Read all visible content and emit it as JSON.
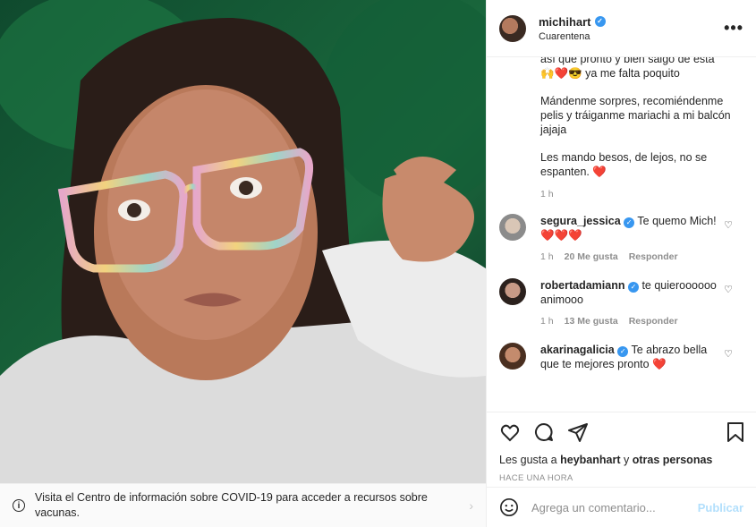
{
  "post": {
    "username": "michihart",
    "location": "Cuarentena",
    "more_label": "•••"
  },
  "caption": {
    "line1": "así que pronto y bien salgo de esta",
    "line2": "🙌❤️😎 ya me falta poquito",
    "para2": "Mándenme sorpres, recomiéndenme pelis y tráiganme mariachi a mi balcón jajaja",
    "para3": "Les mando besos, de lejos, no se espanten. ❤️",
    "time": "1 h"
  },
  "comments": [
    {
      "user": "segura_jessica",
      "verified": true,
      "text": "Te quemo Mich! ❤️❤️❤️",
      "time": "1 h",
      "likes": "20 Me gusta",
      "reply": "Responder"
    },
    {
      "user": "robertadamiann",
      "verified": true,
      "text": "te quieroooooo animooo",
      "time": "1 h",
      "likes": "13 Me gusta",
      "reply": "Responder"
    },
    {
      "user": "akarinagalicia",
      "verified": true,
      "text": "Te abrazo bella que te mejores pronto ❤️"
    }
  ],
  "likes_line": {
    "prefix": "Les gusta a",
    "user": "heybanhart",
    "joiner": "y",
    "others": "otras personas"
  },
  "timestamp": "HACE UNA HORA",
  "add_comment": {
    "placeholder": "Agrega un comentario...",
    "publish": "Publicar"
  },
  "covid_banner": {
    "text": "Visita el Centro de información sobre COVID-19 para acceder a recursos sobre vacunas."
  },
  "icons": {
    "verified": "verified-badge-icon",
    "like": "heart-icon",
    "comment": "comment-icon",
    "share": "share-icon",
    "save": "bookmark-icon",
    "emoji": "emoji-icon",
    "info": "info-icon"
  },
  "colors": {
    "accent": "#3897f0",
    "heart": "#ed4956",
    "publish_disabled": "#b2dffc"
  }
}
